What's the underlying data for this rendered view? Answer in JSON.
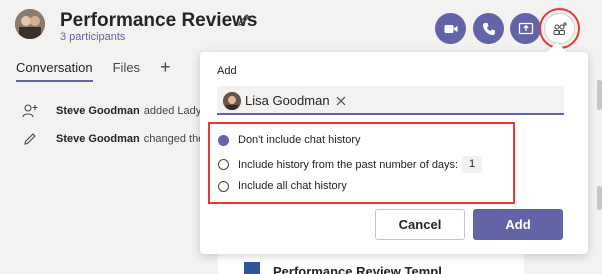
{
  "header": {
    "title": "Performance Reviews",
    "participants": "3 participants"
  },
  "tabs": [
    {
      "label": "Conversation"
    },
    {
      "label": "Files"
    }
  ],
  "tab_add": "+",
  "activity": [
    {
      "user": "Steve Goodman",
      "text": "added Lady"
    },
    {
      "user": "Steve Goodman",
      "text": "changed the"
    }
  ],
  "message_card": {
    "title": "Performance Review Templ"
  },
  "dialog": {
    "title": "Add",
    "selected_person": "Lisa Goodman",
    "options": [
      {
        "label": "Don't include chat history",
        "checked": true
      },
      {
        "label": "Include history from the past number of days:",
        "checked": false,
        "days": "1"
      },
      {
        "label": "Include all chat history",
        "checked": false
      }
    ],
    "cancel_label": "Cancel",
    "add_label": "Add"
  },
  "colors": {
    "accent": "#6264a7",
    "highlight": "#e53935",
    "background": "#f3f2f1"
  },
  "icons": [
    "edit-icon",
    "video-call-icon",
    "audio-call-icon",
    "share-screen-icon",
    "add-people-icon",
    "person-add-icon",
    "pencil-icon",
    "close-icon",
    "word-doc-icon"
  ]
}
